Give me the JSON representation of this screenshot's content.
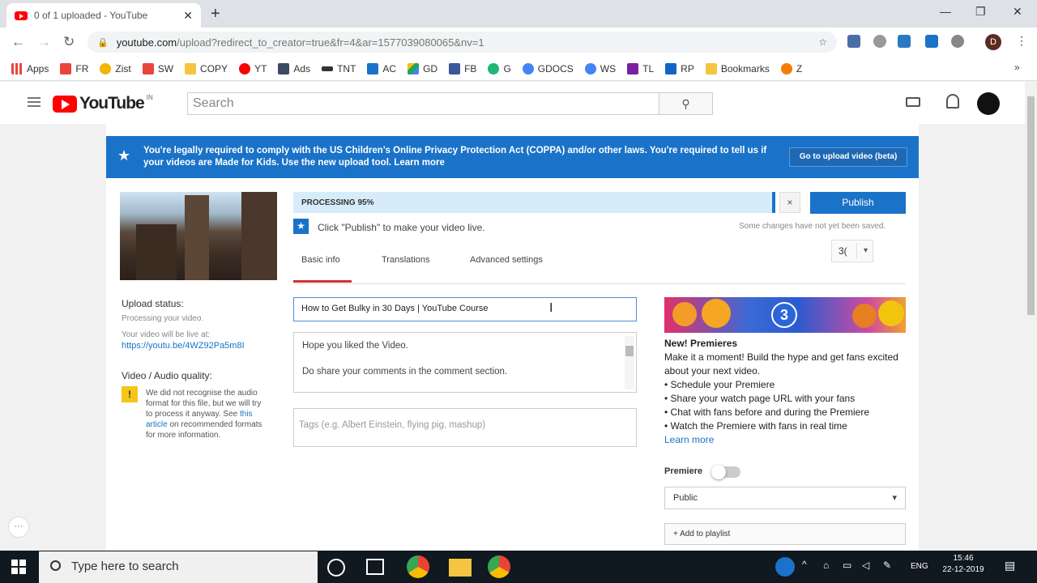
{
  "browser": {
    "tab_title": "0 of 1 uploaded - YouTube",
    "url_host": "youtube.com",
    "url_path": "/upload?redirect_to_creator=true&fr=4&ar=1577039080065&nv=1",
    "profile_initial": "D"
  },
  "bookmarks": [
    {
      "label": "Apps",
      "color": "#e8453c"
    },
    {
      "label": "FR",
      "color": "#e8453c"
    },
    {
      "label": "Zist",
      "color": "#f5b400"
    },
    {
      "label": "SW",
      "color": "#e8453c"
    },
    {
      "label": "COPY",
      "color": "#f5c542"
    },
    {
      "label": "YT",
      "color": "#ff0000"
    },
    {
      "label": "Ads",
      "color": "#3c4b64"
    },
    {
      "label": "TNT",
      "color": "#333333"
    },
    {
      "label": "AC",
      "color": "#1a73c8"
    },
    {
      "label": "GD",
      "color": "#1fa463"
    },
    {
      "label": "FB",
      "color": "#3b5998"
    },
    {
      "label": "G",
      "color": "#22b573"
    },
    {
      "label": "GDOCS",
      "color": "#4285f4"
    },
    {
      "label": "WS",
      "color": "#4285f4"
    },
    {
      "label": "TL",
      "color": "#7b1fa2"
    },
    {
      "label": "RP",
      "color": "#1565c0"
    },
    {
      "label": "Bookmarks",
      "color": "#f5c542"
    },
    {
      "label": "Z",
      "color": "#f57c00"
    }
  ],
  "youtube": {
    "logo_text": "YouTube",
    "logo_region": "IN",
    "search_placeholder": "Search"
  },
  "banner": {
    "text_pre": "You're legally required to comply with the US Children's Online Privacy Protection Act (COPPA) and/or other laws. You're required to tell us if your videos are Made for Kids. Use the new upload tool.",
    "learn_more": "Learn more",
    "go_button": "Go to upload video (beta)"
  },
  "upload": {
    "status_label": "Upload status:",
    "status_text": "Processing your video.",
    "live_text": "Your video will be live at:",
    "live_url": "https://youtu.be/4WZ92Pa5m8I",
    "quality_label": "Video / Audio quality:",
    "quality_note_1": "We did not recognise the audio format for this file, but we will try to process it anyway. See",
    "quality_note_link": "this article",
    "quality_note_2": "on recommended formats for more information."
  },
  "processing": {
    "label": "PROCESSING 95%",
    "percent": 95,
    "close": "×",
    "publish_button": "Publish",
    "hint": "Click \"Publish\" to make your video live.",
    "unsaved": "Some changes have not yet been saved."
  },
  "tabs": [
    "Basic info",
    "Translations",
    "Advanced settings"
  ],
  "language_value": "3(",
  "form": {
    "title_value": "How to Get Bulky in 30 Days | YouTube Course",
    "description_line1": "Hope you liked the Video.",
    "description_line2": "Do share your comments in the comment section.",
    "tags_placeholder": "Tags (e.g. Albert Einstein, flying pig, mashup)"
  },
  "premiere": {
    "countdown": "3",
    "heading": "New! Premieres",
    "intro": "Make it a moment! Build the hype and get fans excited about your next video.",
    "bullets": [
      "Schedule your Premiere",
      "Share your watch page URL with your fans",
      "Chat with fans before and during the Premiere",
      "Watch the Premiere with fans in real time"
    ],
    "learn_more": "Learn more",
    "toggle_label": "Premiere",
    "toggle_on": false,
    "privacy_value": "Public",
    "playlist_button": "+ Add to playlist"
  },
  "taskbar": {
    "search_placeholder": "Type here to search",
    "language": "ENG",
    "time": "15:46",
    "date": "22-12-2019"
  }
}
